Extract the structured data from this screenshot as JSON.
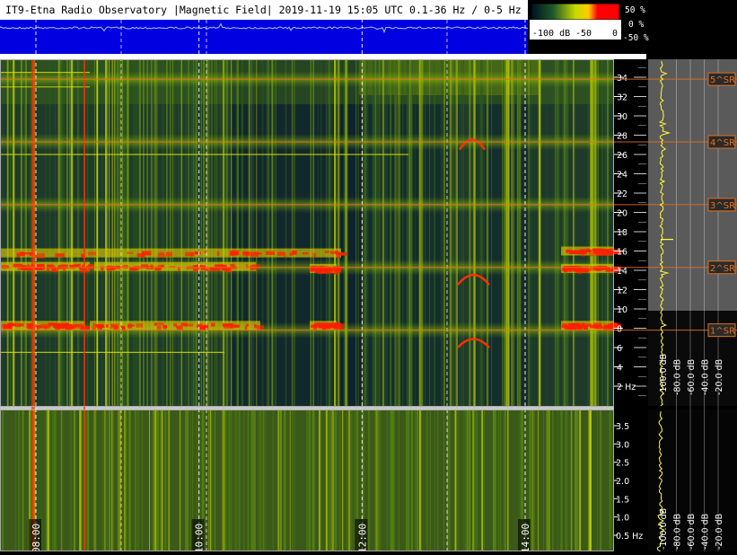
{
  "title": "IT9-Etna Radio Observatory |Magnetic Field| 2019-11-19 15:05 UTC 0.1-36 Hz / 0-5 Hz",
  "colorbar": {
    "min_label": "-100 dB",
    "mid_label": "-50",
    "max_label": "0"
  },
  "waveform_scale": [
    "50 %",
    "0 %",
    "-50 %"
  ],
  "time_ticks": [
    "08:00",
    "10:00",
    "12:00",
    "14:00"
  ],
  "colors": {
    "background": "#000000",
    "spectrogram_low": "#0a1f3d",
    "spectrogram_mid": "#9acd00",
    "spectrogram_high": "#ff2000",
    "waveform_bg": "#0000e0",
    "marker_orange": "#e07020",
    "profile_yellow": "#ffff40"
  },
  "chart_data": [
    {
      "type": "heatmap",
      "title": "IT9-Etna Radio Observatory |Magnetic Field| 2019-11-19 15:05 UTC 0.1-36 Hz / 0-5 Hz",
      "description_panel": "upper spectrogram",
      "x_ticks": [
        "08:00",
        "10:00",
        "12:00",
        "14:00"
      ],
      "y_ticks": [
        "2 Hz",
        "4",
        "6",
        "8",
        "10",
        "12",
        "14",
        "16",
        "18",
        "20",
        "22",
        "24",
        "26",
        "28",
        "30",
        "32",
        "34"
      ],
      "y_range": [
        0.1,
        36
      ],
      "colorbar_range_db": [
        -100,
        0
      ],
      "schumann_resonances": [
        {
          "label": "1^SR",
          "freq_hz": 7.8
        },
        {
          "label": "2^SR",
          "freq_hz": 14.3
        },
        {
          "label": "3^SR",
          "freq_hz": 20.8
        },
        {
          "label": "4^SR",
          "freq_hz": 27.3
        },
        {
          "label": "5^SR",
          "freq_hz": 33.8
        }
      ]
    },
    {
      "type": "heatmap",
      "description_panel": "lower spectrogram",
      "x_ticks": [
        "08:00",
        "10:00",
        "12:00",
        "14:00"
      ],
      "y_ticks": [
        "0.5 Hz",
        "1.0",
        "1.5",
        "2.0",
        "2.5",
        "3.0",
        "3.5"
      ],
      "y_range": [
        0,
        4
      ]
    },
    {
      "type": "line",
      "description_panel": "average spectrum profiles",
      "x_ticks": [
        "-100.0 dB",
        "-80.0 dB",
        "-60.0 dB",
        "-40.0 dB",
        "-20.0 dB"
      ],
      "xlim": [
        -100,
        -20
      ]
    }
  ]
}
